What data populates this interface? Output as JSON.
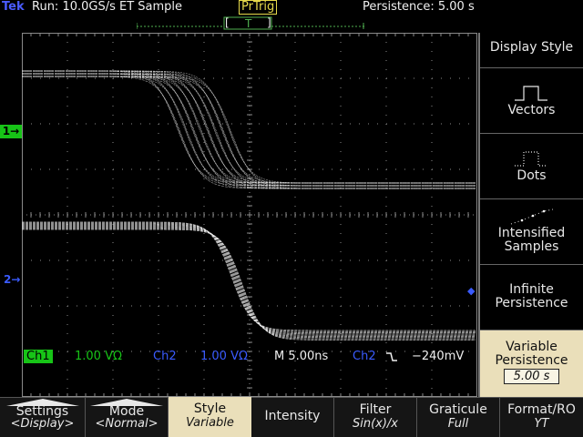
{
  "status": {
    "brand": "Tek",
    "run": "Run: 10.0GS/s ET Sample",
    "trigger_state": "PrTrig",
    "persistence": "Persistence: 5.00 s",
    "trigger_marker": "T"
  },
  "markers": {
    "ch1": "1→",
    "ch2": "2→"
  },
  "readout": {
    "ch1_badge": "Ch1",
    "ch1_scale": "1.00 VΩ",
    "ch2_label": "Ch2",
    "ch2_scale": "1.00 VΩ",
    "timebase": "M 5.00ns",
    "trig_source": "Ch2",
    "trig_level": "−240mV"
  },
  "side_menu": {
    "title": "Display Style",
    "vectors": "Vectors",
    "dots": "Dots",
    "intensified": "Intensified Samples",
    "infinite": "Infinite Persistence",
    "variable_label": "Variable Persistence",
    "variable_value": "5.00 s"
  },
  "bottom_menu": [
    {
      "label": "Settings",
      "sub": "<Display>"
    },
    {
      "label": "Mode",
      "sub": "<Normal>"
    },
    {
      "label": "Style",
      "sub": "Variable"
    },
    {
      "label": "Intensity",
      "sub": ""
    },
    {
      "label": "Filter",
      "sub": "Sin(x)/x"
    },
    {
      "label": "Graticule",
      "sub": "Full"
    },
    {
      "label": "Format/RO",
      "sub": "YT"
    }
  ],
  "colors": {
    "ch1": "#f0f0f0",
    "ch2": "#3a5bff",
    "ch1_badge_bg": "#17c417",
    "menu_active": "#eadfba",
    "trigger": "#e6d94a"
  }
}
